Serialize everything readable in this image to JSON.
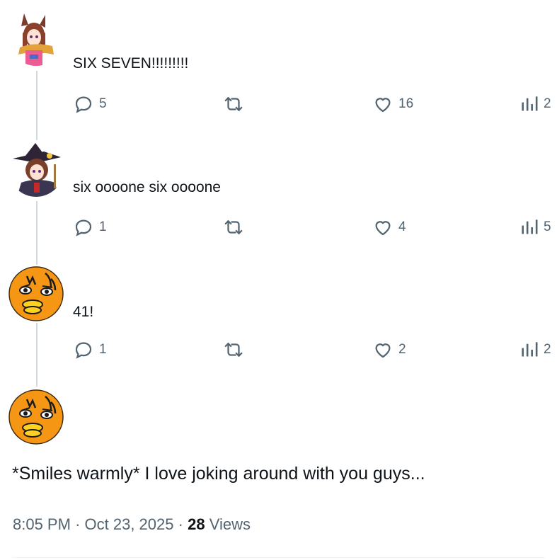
{
  "replies": [
    {
      "text": "SIX SEVEN!!!!!!!!!",
      "avatar": "anime-horse-girl-avatar",
      "stats": {
        "replies": "5",
        "reposts": "",
        "likes": "16",
        "views": "2"
      }
    },
    {
      "text": "six oooone six oooone",
      "avatar": "anime-witch-avatar",
      "stats": {
        "replies": "1",
        "reposts": "",
        "likes": "4",
        "views": "5"
      }
    },
    {
      "text": "41!",
      "avatar": "orange-duck-avatar",
      "stats": {
        "replies": "1",
        "reposts": "",
        "likes": "2",
        "views": "2"
      }
    }
  ],
  "main_post": {
    "avatar": "orange-duck-avatar",
    "text": "*Smiles warmly* I love joking around with you guys...",
    "time": "8:05 PM",
    "separator": "·",
    "date": "Oct 23, 2025",
    "views_count": "28",
    "views_label": "Views"
  },
  "colors": {
    "text": "#0f1419",
    "secondary": "#536471",
    "thread_line": "#cfd9de",
    "avatar_orange": "#f59614"
  },
  "icons": [
    "reply-icon",
    "repost-icon",
    "like-icon",
    "views-icon"
  ]
}
